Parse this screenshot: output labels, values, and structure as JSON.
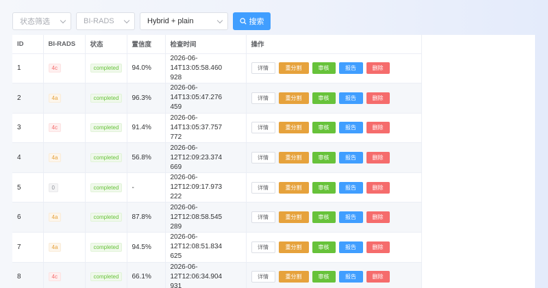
{
  "filters": {
    "status_placeholder": "状态筛选",
    "birads_placeholder": "BI-RADS",
    "mode_value": "Hybrid + plain",
    "search_label": "搜索"
  },
  "table": {
    "columns": [
      "ID",
      "BI-RADS",
      "状态",
      "置信度",
      "检查时间",
      "操作"
    ],
    "actions": {
      "detail": "详情",
      "regrade": "重分割",
      "review": "审核",
      "report": "报告",
      "delete": "删除"
    },
    "rows": [
      {
        "id": "1",
        "birads": "4c",
        "status": "completed",
        "confidence": "94.0%",
        "time_line1": "2026-06-14T13:05:58.460",
        "time_line2": "928"
      },
      {
        "id": "2",
        "birads": "4a",
        "status": "completed",
        "confidence": "96.3%",
        "time_line1": "2026-06-14T13:05:47.276",
        "time_line2": "459"
      },
      {
        "id": "3",
        "birads": "4c",
        "status": "completed",
        "confidence": "91.4%",
        "time_line1": "2026-06-14T13:05:37.757",
        "time_line2": "772"
      },
      {
        "id": "4",
        "birads": "4a",
        "status": "completed",
        "confidence": "56.8%",
        "time_line1": "2026-06-12T12:09:23.374",
        "time_line2": "669"
      },
      {
        "id": "5",
        "birads": "0",
        "status": "completed",
        "confidence": "-",
        "time_line1": "2026-06-12T12:09:17.973",
        "time_line2": "222"
      },
      {
        "id": "6",
        "birads": "4a",
        "status": "completed",
        "confidence": "87.8%",
        "time_line1": "2026-06-12T12:08:58.545",
        "time_line2": "289"
      },
      {
        "id": "7",
        "birads": "4a",
        "status": "completed",
        "confidence": "94.5%",
        "time_line1": "2026-06-12T12:08:51.834",
        "time_line2": "625"
      },
      {
        "id": "8",
        "birads": "4c",
        "status": "completed",
        "confidence": "66.1%",
        "time_line1": "2026-06-12T12:06:34.904",
        "time_line2": "931"
      }
    ]
  },
  "colors": {
    "primary": "#409eff",
    "warning": "#e6a23c",
    "success": "#67c23a",
    "danger": "#f56c6c",
    "info": "#909399"
  }
}
